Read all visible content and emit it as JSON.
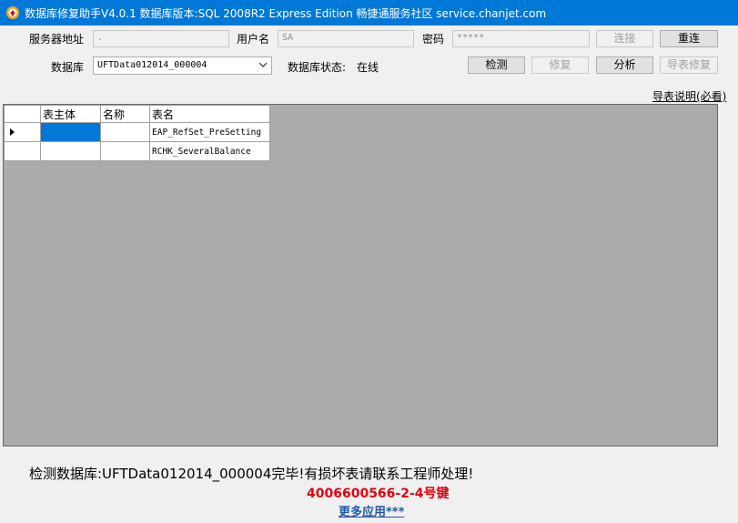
{
  "window": {
    "title": "数据库修复助手V4.0.1 数据库版本:SQL 2008R2 Express Edition  畅捷通服务社区 service.chanjet.com"
  },
  "form": {
    "server_label": "服务器地址",
    "server_value": ".",
    "username_label": "用户名",
    "username_value": "SA",
    "password_label": "密码",
    "password_value": "*****",
    "connect_button": "连接",
    "reconnect_button": "重连",
    "database_label": "数据库",
    "database_selected": "UFTData012014_000004",
    "db_status_label": "数据库状态:",
    "db_status_value": "在线",
    "check_button": "检测",
    "repair_button": "修复",
    "analyze_button": "分析",
    "export_repair_button": "导表修复",
    "table_help_link": "导表说明(必看)"
  },
  "grid": {
    "columns": [
      "表主体",
      "名称",
      "表名"
    ],
    "rows": [
      {
        "c1": "",
        "c2": "",
        "c3": "EAP_RefSet_PreSetting"
      },
      {
        "c1": "",
        "c2": "",
        "c3": "RCHK_SeveralBalance"
      }
    ]
  },
  "footer": {
    "status_message": "检测数据库:UFTData012014_000004完毕!有损坏表请联系工程师处理!",
    "phone": "4006600566-2-4号键",
    "more_apps_link": "更多应用***"
  },
  "colors": {
    "titlebar": "#0078d7",
    "selection": "#0078d7",
    "phone_text": "#e3000f",
    "link_text": "#1e5aa8"
  }
}
